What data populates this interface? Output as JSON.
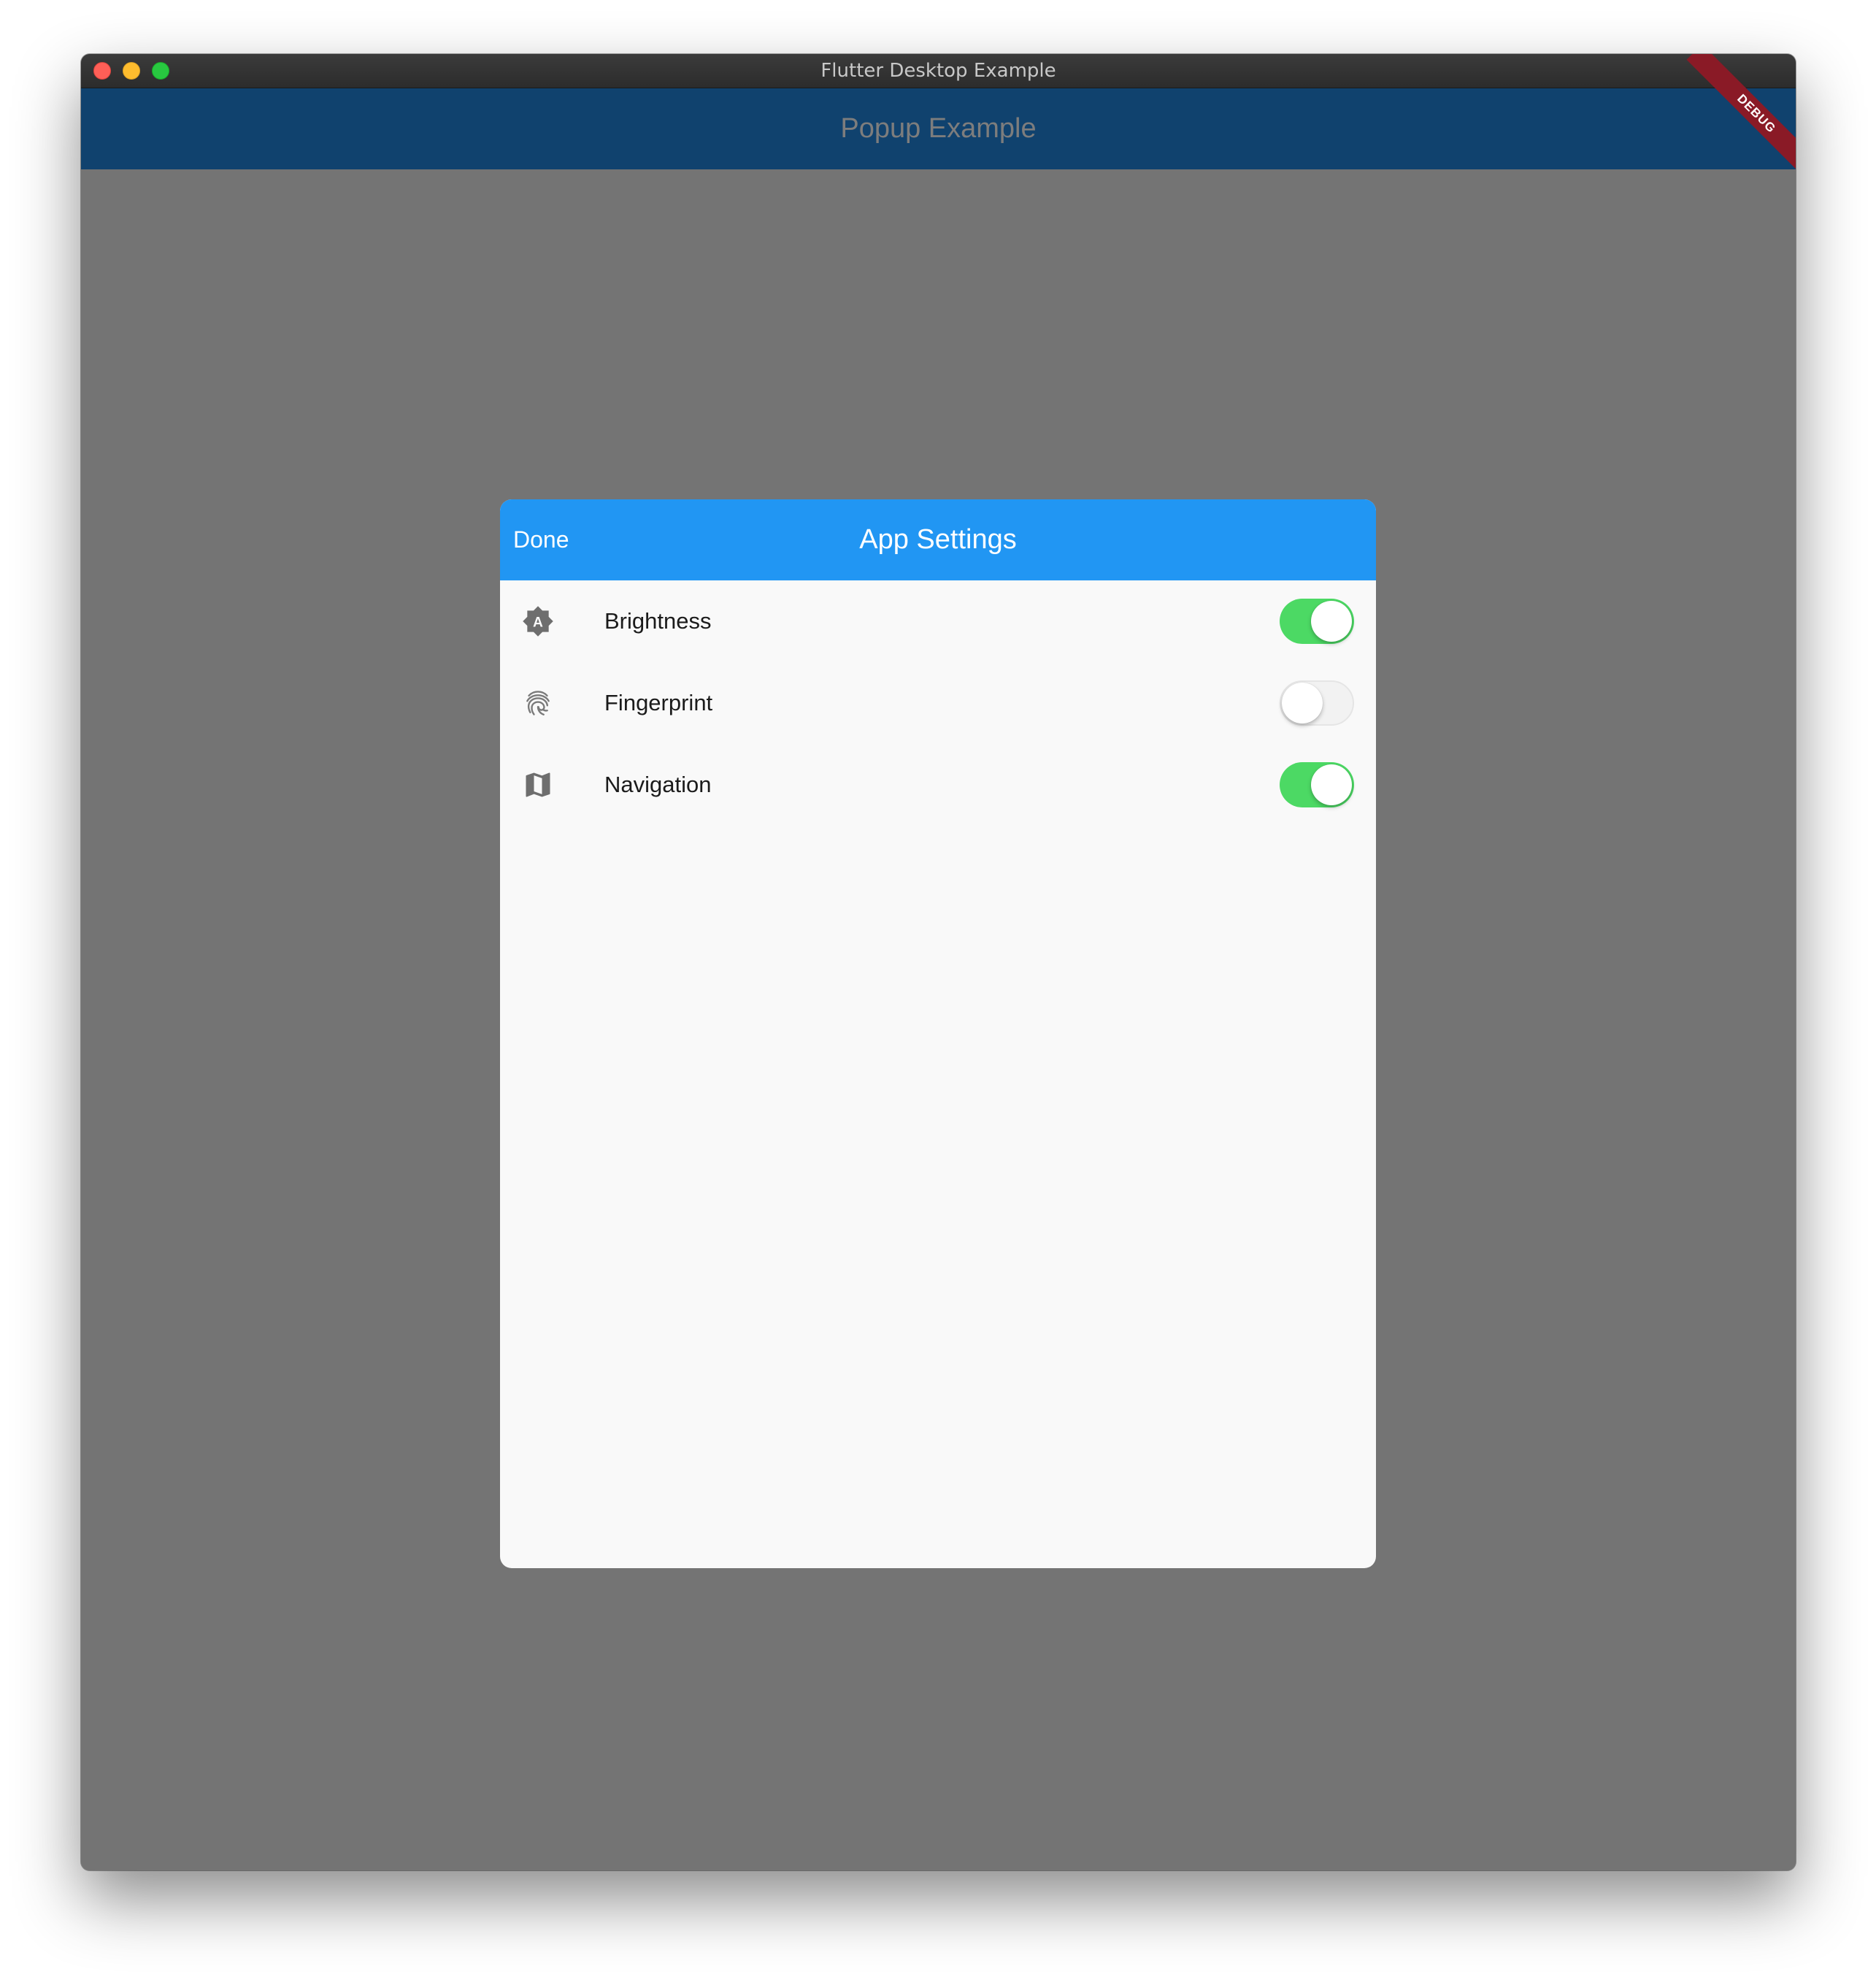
{
  "window": {
    "title": "Flutter Desktop Example"
  },
  "appbar": {
    "title": "Popup Example",
    "debug_banner": "DEBUG"
  },
  "dialog": {
    "done_label": "Done",
    "title": "App Settings",
    "items": [
      {
        "label": "Brightness",
        "icon": "brightness-auto-icon",
        "enabled": true
      },
      {
        "label": "Fingerprint",
        "icon": "fingerprint-icon",
        "enabled": false
      },
      {
        "label": "Navigation",
        "icon": "map-icon",
        "enabled": true
      }
    ]
  },
  "colors": {
    "appbar": "#10426e",
    "dialog_header": "#2196f3",
    "switch_on": "#4cd964",
    "scrim": "#747474",
    "debug_banner": "#8a1a26"
  }
}
